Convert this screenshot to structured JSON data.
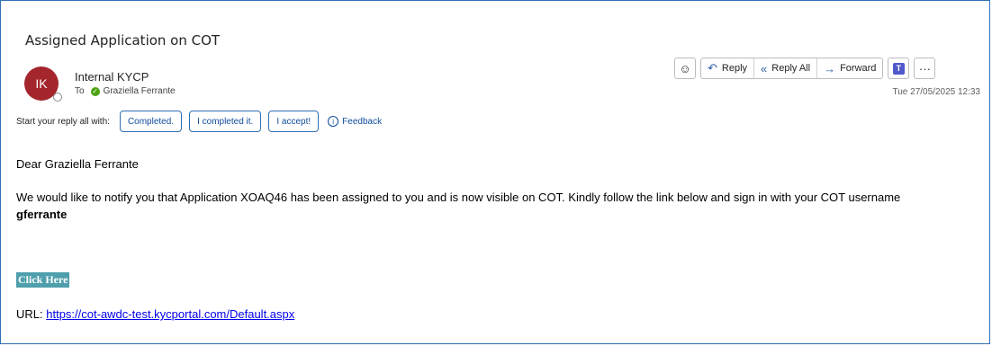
{
  "email": {
    "subject": "Assigned Application on COT",
    "sender": {
      "initials": "IK",
      "name": "Internal KYCP"
    },
    "to_label": "To",
    "recipient": "Graziella Ferrante",
    "datetime": "Tue 27/05/2025 12:33"
  },
  "toolbar": {
    "emoji_icon": "smiley-icon",
    "reply_label": "Reply",
    "reply_all_label": "Reply All",
    "forward_label": "Forward",
    "teams_icon": "teams-icon",
    "more_label": "···"
  },
  "suggested_replies": {
    "prompt": "Start your reply all with:",
    "items": [
      "Completed.",
      "I completed it.",
      "I accept!"
    ],
    "feedback_label": "Feedback"
  },
  "message": {
    "greeting": "Dear Graziella Ferrante",
    "paragraph": "We would like to notify you that Application XOAQ46 has been assigned to you and is now visible on COT. Kindly follow the link below and sign in with your COT username",
    "username": "gferrante",
    "click_here": "Click Here",
    "url_label": "URL:",
    "url": "https://cot-awdc-test.kycportal.com/Default.aspx"
  },
  "colors": {
    "avatar": "#a4262c",
    "accent": "#2c5fa8",
    "click_here_bg": "#4f9fad"
  }
}
